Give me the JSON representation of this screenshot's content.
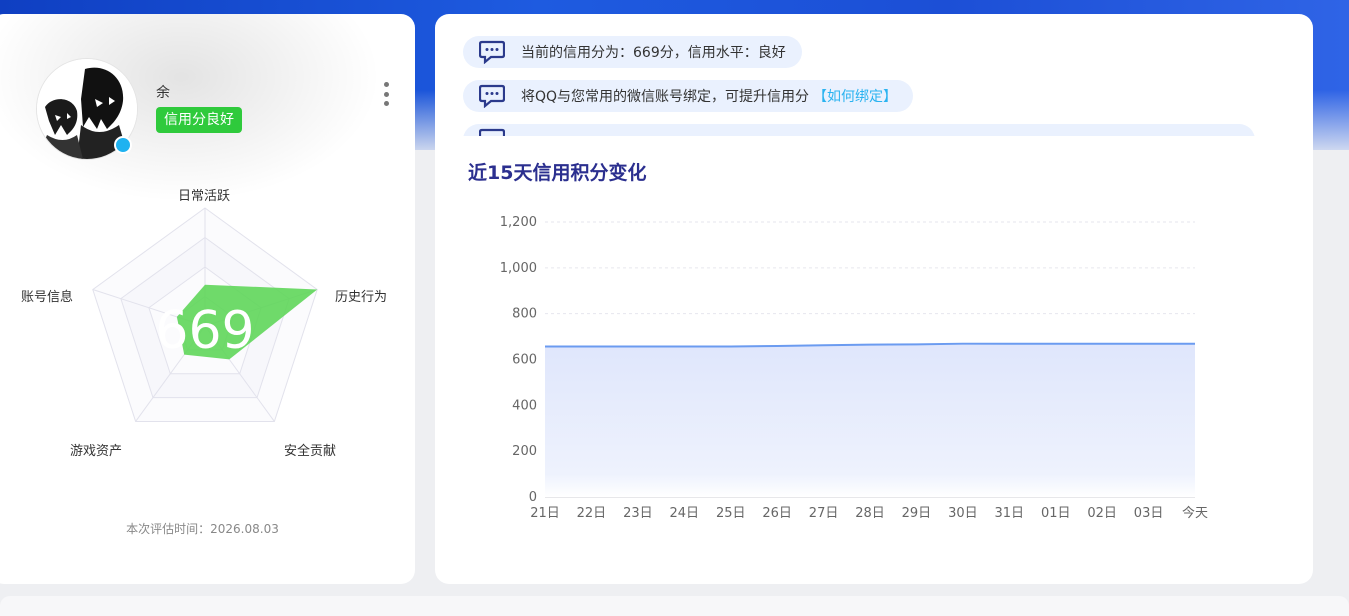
{
  "profile": {
    "name": "余",
    "credit_badge": "信用分良好",
    "avatar_icon": "avatar-image",
    "more_icon": "more-vertical-icon"
  },
  "radar": {
    "score": "669",
    "dimensions": [
      "日常活跃",
      "历史行为",
      "安全贡献",
      "游戏资产",
      "账号信息"
    ],
    "values": [
      0.35,
      1.0,
      0.35,
      0.3,
      0.25
    ],
    "fill_color": "#5fd65a"
  },
  "eval_time": "本次评估时间：2026.08.03",
  "tips": [
    {
      "text": "当前的信用分为：669分，信用水平：良好",
      "link": "",
      "icon": "chat-message-icon"
    },
    {
      "text": "将QQ与您常用的微信账号绑定，可提升信用分",
      "link": "【如何绑定】",
      "icon": "chat-message-icon"
    }
  ],
  "chart_data": {
    "type": "area",
    "title": "近15天信用积分变化",
    "categories": [
      "21日",
      "22日",
      "23日",
      "24日",
      "25日",
      "26日",
      "27日",
      "28日",
      "29日",
      "30日",
      "31日",
      "01日",
      "02日",
      "03日",
      "今天"
    ],
    "values": [
      657,
      657,
      657,
      657,
      657,
      659,
      662,
      665,
      666,
      669,
      669,
      669,
      669,
      669,
      669
    ],
    "yticks": [
      "0",
      "200",
      "400",
      "600",
      "800",
      "1,000",
      "1,200"
    ],
    "ylim": [
      0,
      1200
    ],
    "grid": true,
    "line_color": "#6b9bf0",
    "area_color": "#d8e2fb"
  }
}
